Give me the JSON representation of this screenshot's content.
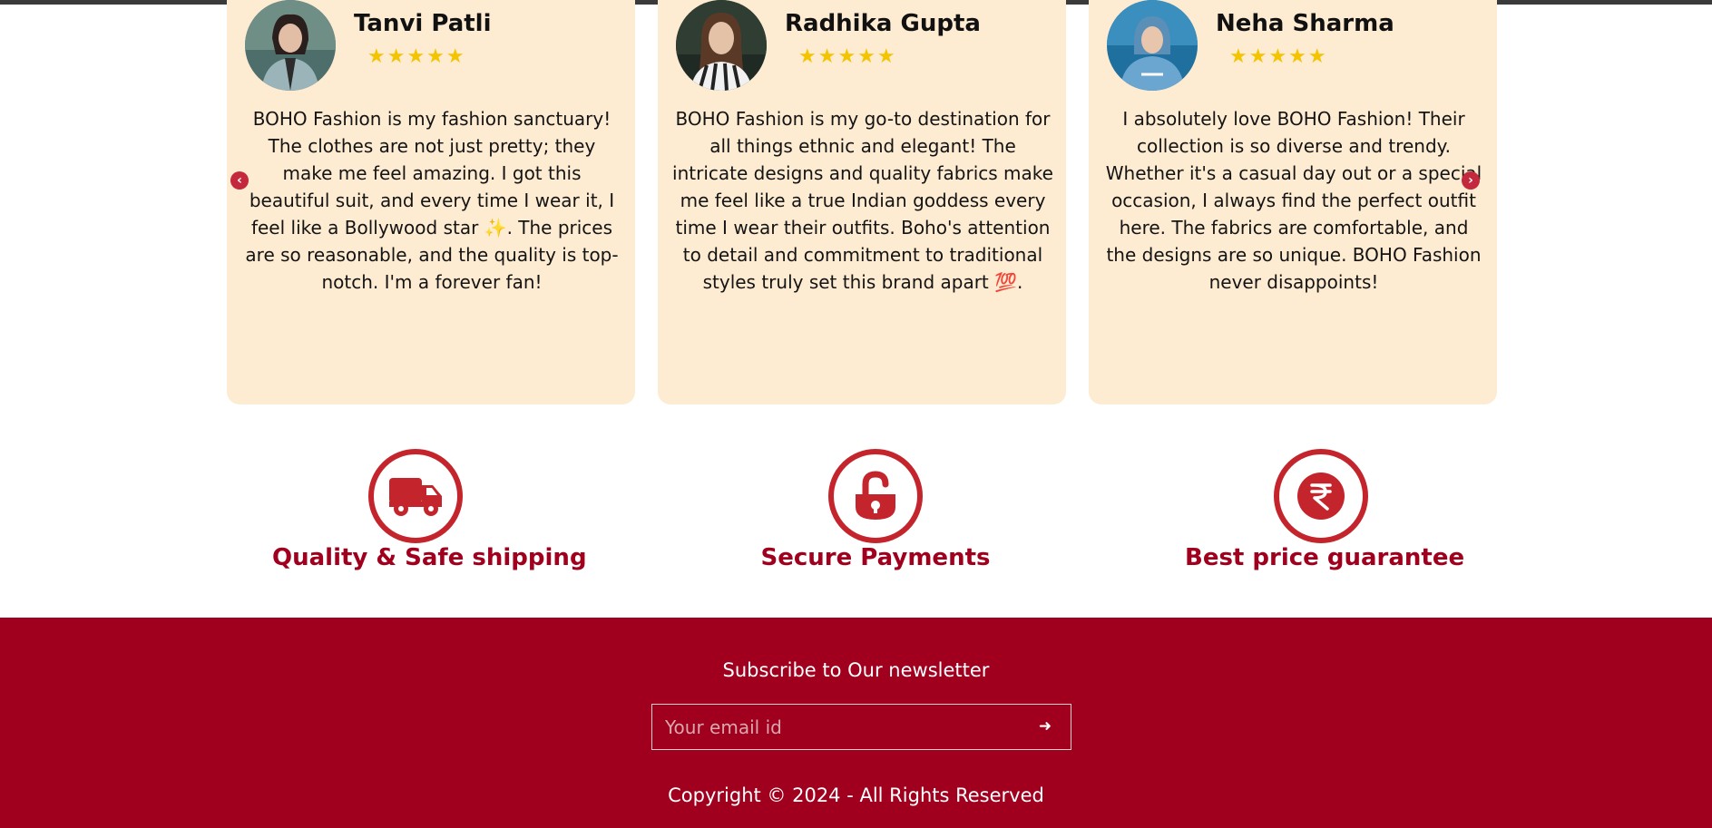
{
  "testimonials": [
    {
      "name": "Tanvi Patli",
      "stars": "★★★★★",
      "review": "BOHO Fashion is my fashion sanctuary! The clothes are not just pretty; they make me feel amazing. I got this beautiful suit, and every time I wear it, I feel like a Bollywood star ✨. The prices are so reasonable, and the quality is top-notch. I'm a forever fan!"
    },
    {
      "name": "Radhika Gupta",
      "stars": "★★★★★",
      "review": "BOHO Fashion is my go-to destination for all things ethnic and elegant! The intricate designs and quality fabrics make me feel like a true Indian goddess every time I wear their outfits. Boho's attention to detail and commitment to traditional styles truly set this brand apart 💯."
    },
    {
      "name": "Neha Sharma",
      "stars": "★★★★★",
      "review": "I absolutely love BOHO Fashion! Their collection is so diverse and trendy. Whether it's a casual day out or a special occasion, I always find the perfect outfit here. The fabrics are comfortable, and the designs are so unique. BOHO Fashion never disappoints!"
    }
  ],
  "carousel": {
    "prev_icon": "chevron-left-icon",
    "next_icon": "chevron-right-icon"
  },
  "features": [
    {
      "label": "Quality & Safe shipping",
      "icon": "truck-icon"
    },
    {
      "label": "Secure Payments",
      "icon": "unlock-icon"
    },
    {
      "label": "Best price guarantee",
      "icon": "rupee-icon"
    }
  ],
  "newsletter": {
    "title": "Subscribe to Our newsletter",
    "placeholder": "Your email id",
    "submit_icon": "arrow-right-icon"
  },
  "footer": {
    "copyright": "Copyright © 2024 - All Rights Reserved"
  },
  "colors": {
    "card_bg": "#fdebd2",
    "accent": "#a0001e",
    "icon_red": "#c4242b",
    "star": "#f4c400"
  }
}
